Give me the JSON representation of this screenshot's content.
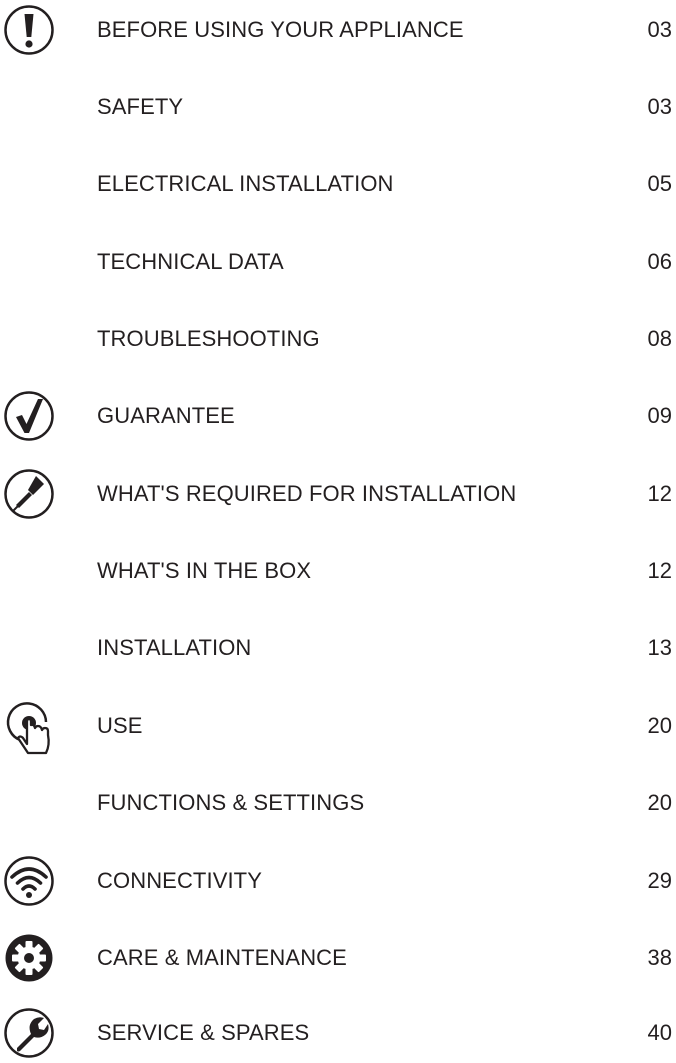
{
  "entries": [
    {
      "label": "BEFORE USING YOUR APPLIANCE",
      "page": "03",
      "icon": "exclamation-icon"
    },
    {
      "label": "SAFETY",
      "page": "03",
      "icon": ""
    },
    {
      "label": "ELECTRICAL INSTALLATION",
      "page": "05",
      "icon": ""
    },
    {
      "label": "TECHNICAL DATA",
      "page": "06",
      "icon": ""
    },
    {
      "label": "TROUBLESHOOTING",
      "page": "08",
      "icon": ""
    },
    {
      "label": "GUARANTEE",
      "page": "09",
      "icon": "checkmark-icon"
    },
    {
      "label": "WHAT'S REQUIRED FOR INSTALLATION",
      "page": "12",
      "icon": "screwdriver-icon"
    },
    {
      "label": "WHAT'S IN THE BOX",
      "page": "12",
      "icon": ""
    },
    {
      "label": "INSTALLATION",
      "page": "13",
      "icon": ""
    },
    {
      "label": "USE",
      "page": "20",
      "icon": "touch-hand-icon"
    },
    {
      "label": "FUNCTIONS & SETTINGS",
      "page": "20",
      "icon": ""
    },
    {
      "label": "CONNECTIVITY",
      "page": "29",
      "icon": "wifi-icon"
    },
    {
      "label": "CARE & MAINTENANCE",
      "page": "38",
      "icon": "gear-icon"
    },
    {
      "label": "SERVICE & SPARES",
      "page": "40",
      "icon": "wrench-icon"
    }
  ],
  "colors": {
    "text": "#231f20",
    "background": "#ffffff"
  }
}
